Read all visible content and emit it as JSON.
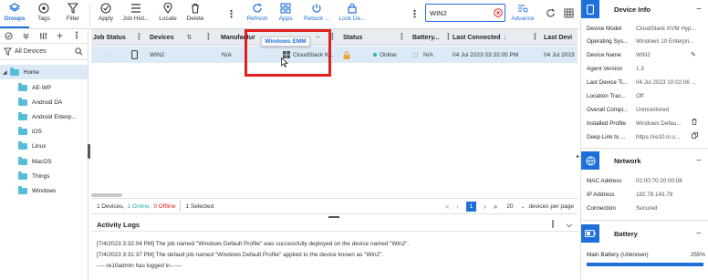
{
  "toolbar": {
    "groups": "Groups",
    "tags": "Tags",
    "filter": "Filter",
    "apply": "Apply",
    "job_history": "Job Hist...",
    "locate": "Locate",
    "delete": "Delete",
    "refresh": "Refresh",
    "apps": "Apps",
    "reboot": "Reboot ...",
    "lock": "Lock De...",
    "search_value": "WIN2",
    "advance": "Advance"
  },
  "sidebar": {
    "all_devices": "All Devices",
    "home": "Home",
    "items": [
      "AE-WP",
      "Android DA",
      "Android Enterp...",
      "iOS",
      "Linux",
      "MacOS",
      "Things",
      "Windows"
    ]
  },
  "grid": {
    "columns": [
      "Job Status",
      "Devices",
      "Manufactur",
      "Status",
      "Battery...",
      "Last Connected",
      "Last Devi"
    ],
    "row": {
      "device": "WIN2",
      "manufacturer": "N/A",
      "os_model": "CloudStack K...",
      "status": "Online",
      "battery": "N/A",
      "last_connected": "04 Jul 2023 03:32:05 PM",
      "last_device": "04 Jul 2023"
    },
    "tooltip": "Windows EMM"
  },
  "pager": {
    "devices_total": "1 Devices,",
    "online": "1 Online,",
    "offline": "0 Offline",
    "selected": "1 Selected",
    "page": "1",
    "per_page": "20",
    "per_page_label": "devices per page"
  },
  "activity": {
    "title": "Activity Logs",
    "lines": [
      "[7/4/2023 3:32:04 PM] The job named \"Windows Default Profile\" was successfully deployed on the device named \"Win2\".",
      "[7/4/2023 3:31:37 PM] The default job named \"Windows Default Profile\" applied to the device known as \"Win2\".",
      "-----re10admin has logged in.-----"
    ]
  },
  "device_info": {
    "title": "Device Info",
    "rows": [
      {
        "k": "Device Model",
        "v": "CloudStack KVM Hyp..."
      },
      {
        "k": "Operating Sys...",
        "v": "Windows 10 Enterpri..."
      },
      {
        "k": "Device Name",
        "v": "WIN2"
      },
      {
        "k": "Agent Version",
        "v": "1.3"
      },
      {
        "k": "Last Device Ti...",
        "v": "04 Jul 2023 10:02:06 ..."
      },
      {
        "k": "Location Trac...",
        "v": "Off"
      },
      {
        "k": "Overall Compl...",
        "v": "Unmonitored"
      },
      {
        "k": "Installed Profile",
        "v": "Windows Defau..."
      },
      {
        "k": "Deep Link to ...",
        "v": "https://re10.in.s..."
      }
    ]
  },
  "network": {
    "title": "Network",
    "rows": [
      {
        "k": "MAC Address",
        "v": "02:00:70:20:00:08"
      },
      {
        "k": "IP Address",
        "v": "182.78.143.78"
      },
      {
        "k": "Connection",
        "v": "Secured"
      }
    ]
  },
  "battery": {
    "title": "Battery",
    "main_label": "Main Battery (Unknown)",
    "main_value": "255%",
    "level": 1.0
  },
  "colors": {
    "accent": "#1e6fd9",
    "online": "#2ab0a6",
    "highlight": "#e02020",
    "folder": "#56bdd9"
  }
}
